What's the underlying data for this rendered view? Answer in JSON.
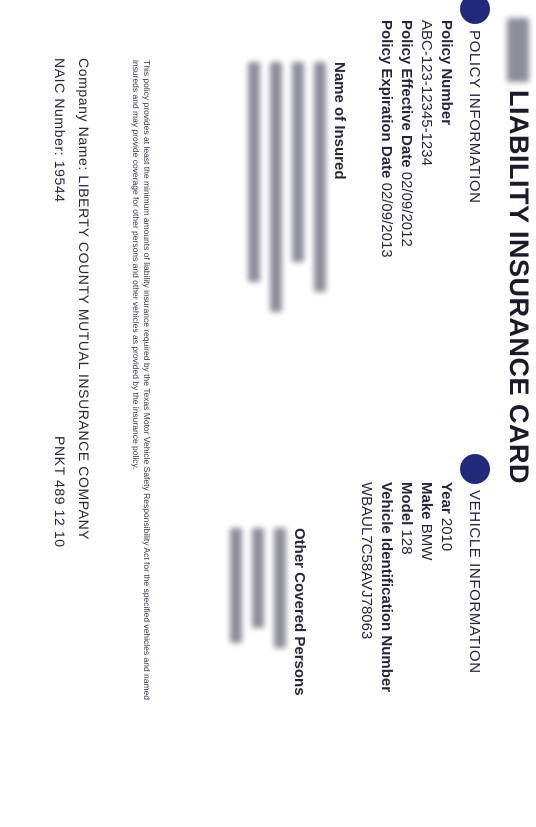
{
  "card": {
    "title": "LIABILITY INSURANCE CARD",
    "policy": {
      "heading": "POLICY INFORMATION",
      "number_label": "Policy Number",
      "number_value": "ABC-123-12345-1234",
      "effective_label": "Policy Effective Date",
      "effective_value": "02/09/2012",
      "expiration_label": "Policy Expiration Date",
      "expiration_value": "02/09/2013",
      "insured_label": "Name of Insured"
    },
    "vehicle": {
      "heading": "VEHICLE INFORMATION",
      "year_label": "Year",
      "year_value": "2010",
      "make_label": "Make",
      "make_value": "BMW",
      "model_label": "Model",
      "model_value": "128",
      "vin_label": "Vehicle Identification Number",
      "vin_value": "WBAUL7C58AVJ78063",
      "other_label": "Other Covered Persons"
    },
    "disclaimer": "This policy provides at least the minimum amounts of liability insurance required by the Texas Motor Vehicle Safety Responsibility Act for the specified vehicles and named insureds and may provide coverage for other persons and other vehicles as provided by the insurance policy.",
    "company_line": "Company Name: LIBERTY COUNTY MUTUAL INSURANCE COMPANY",
    "naic_line": "NAIC Number: 19544",
    "form_code": "PNKT 489 12 10"
  },
  "colors": {
    "accent_dot": "#1f2a7a",
    "text": "#25253c"
  }
}
